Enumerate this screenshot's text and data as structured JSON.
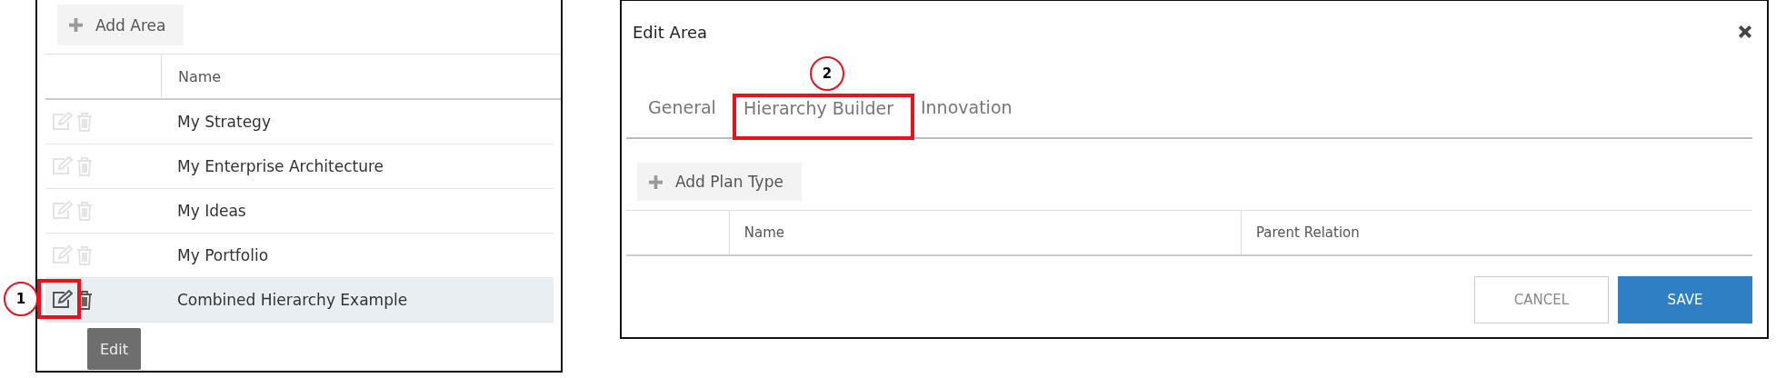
{
  "areas_panel": {
    "add_button": "Add Area",
    "columns": [
      "Name"
    ],
    "rows": [
      {
        "name": "My Strategy",
        "selected": false
      },
      {
        "name": "My Enterprise Architecture",
        "selected": false
      },
      {
        "name": "My Ideas",
        "selected": false
      },
      {
        "name": "My Portfolio",
        "selected": false
      },
      {
        "name": "Combined Hierarchy Example",
        "selected": true
      }
    ],
    "tooltip": "Edit"
  },
  "dialog": {
    "title": "Edit Area",
    "tabs": [
      {
        "label": "General",
        "selected": false
      },
      {
        "label": "Hierarchy Builder",
        "selected": true
      },
      {
        "label": "Innovation",
        "selected": false
      }
    ],
    "add_button": "Add Plan Type",
    "columns": [
      "Name",
      "Parent Relation"
    ],
    "buttons": [
      {
        "label": "CANCEL",
        "kind": "secondary"
      },
      {
        "label": "SAVE",
        "kind": "primary"
      }
    ]
  },
  "annotations": [
    "1",
    "2"
  ]
}
